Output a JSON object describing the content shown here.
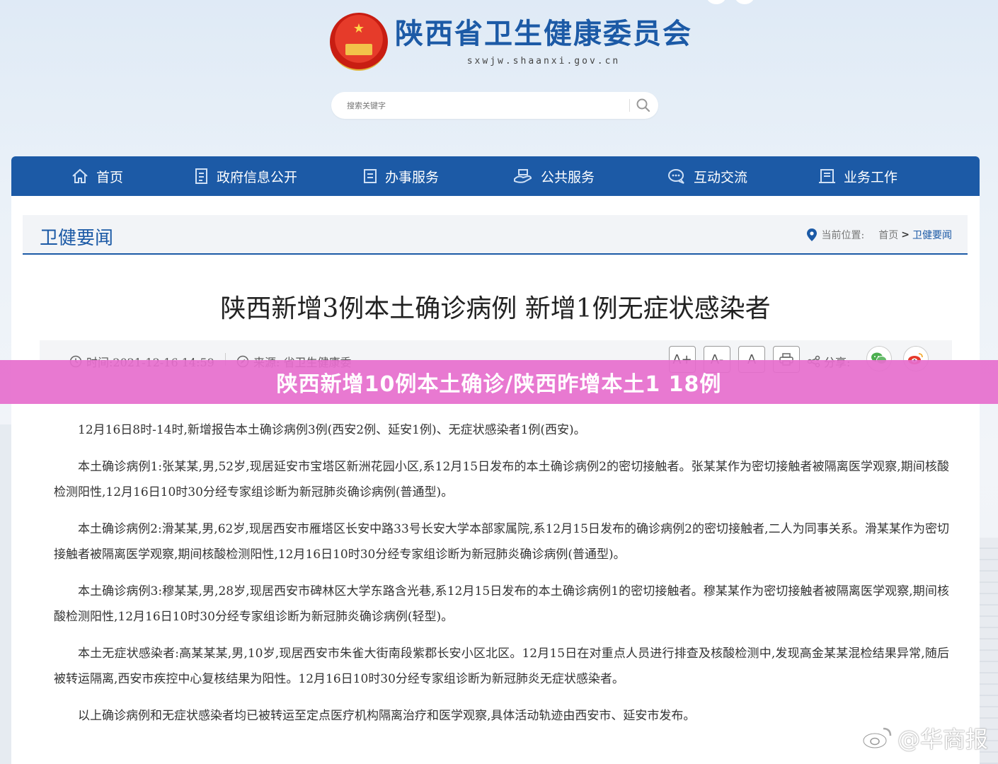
{
  "site": {
    "name": "陕西省卫生健康委员会",
    "url": "sxwjw.shaanxi.gov.cn"
  },
  "search": {
    "placeholder": "搜索关键字"
  },
  "nav": {
    "items": [
      {
        "label": "首页",
        "icon": "home-icon"
      },
      {
        "label": "政府信息公开",
        "icon": "document-icon"
      },
      {
        "label": "办事服务",
        "icon": "list-icon"
      },
      {
        "label": "公共服务",
        "icon": "service-icon"
      },
      {
        "label": "互动交流",
        "icon": "chat-icon"
      },
      {
        "label": "业务工作",
        "icon": "work-icon"
      }
    ]
  },
  "column": {
    "title": "卫健要闻",
    "breadcrumb": {
      "label": "当前位置:",
      "home": "首页",
      "separator": ">",
      "current": "卫健要闻"
    }
  },
  "article": {
    "title": "陕西新增3例本土确诊病例 新增1例无症状感染者",
    "time": "时间:2021-12-16 14:59",
    "source": "来源: 省卫生健康委",
    "font_buttons": [
      "A+",
      "A-",
      "A"
    ],
    "share_label": "分享:",
    "paragraphs": [
      "12月16日8时-14时,新增报告本土确诊病例3例(西安2例、延安1例)、无症状感染者1例(西安)。",
      "本土确诊病例1:张某某,男,52岁,现居延安市宝塔区新洲花园小区,系12月15日发布的本土确诊病例2的密切接触者。张某某作为密切接触者被隔离医学观察,期间核酸检测阳性,12月16日10时30分经专家组诊断为新冠肺炎确诊病例(普通型)。",
      "本土确诊病例2:滑某某,男,62岁,现居西安市雁塔区长安中路33号长安大学本部家属院,系12月15日发布的确诊病例2的密切接触者,二人为同事关系。滑某某作为密切接触者被隔离医学观察,期间核酸检测阳性,12月16日10时30分经专家组诊断为新冠肺炎确诊病例(普通型)。",
      "本土确诊病例3:穆某某,男,28岁,现居西安市碑林区大学东路含光巷,系12月15日发布的本土确诊病例1的密切接触者。穆某某作为密切接触者被隔离医学观察,期间核酸检测阳性,12月16日10时30分经专家组诊断为新冠肺炎确诊病例(轻型)。",
      "本土无症状感染者:高某某某,男,10岁,现居西安市朱雀大街南段紫郡长安小区北区。12月15日在对重点人员进行排查及核酸检测中,发现高金某某混检结果异常,随后被转运隔离,西安市疾控中心复核结果为阳性。12月16日10时30分经专家组诊断为新冠肺炎无症状感染者。",
      "以上确诊病例和无症状感染者均已被转运至定点医疗机构隔离治疗和医学观察,具体活动轨迹由西安市、延安市发布。"
    ]
  },
  "banner": {
    "text": "陕西新增10例本土确诊/陕西昨增本土1 18例"
  },
  "watermark": {
    "text": "@华商报"
  },
  "colors": {
    "brand_blue": "#1c5aa6",
    "banner_pink": "#e66ecd",
    "wechat_green": "#4caf50",
    "weibo_red": "#e6392b"
  }
}
